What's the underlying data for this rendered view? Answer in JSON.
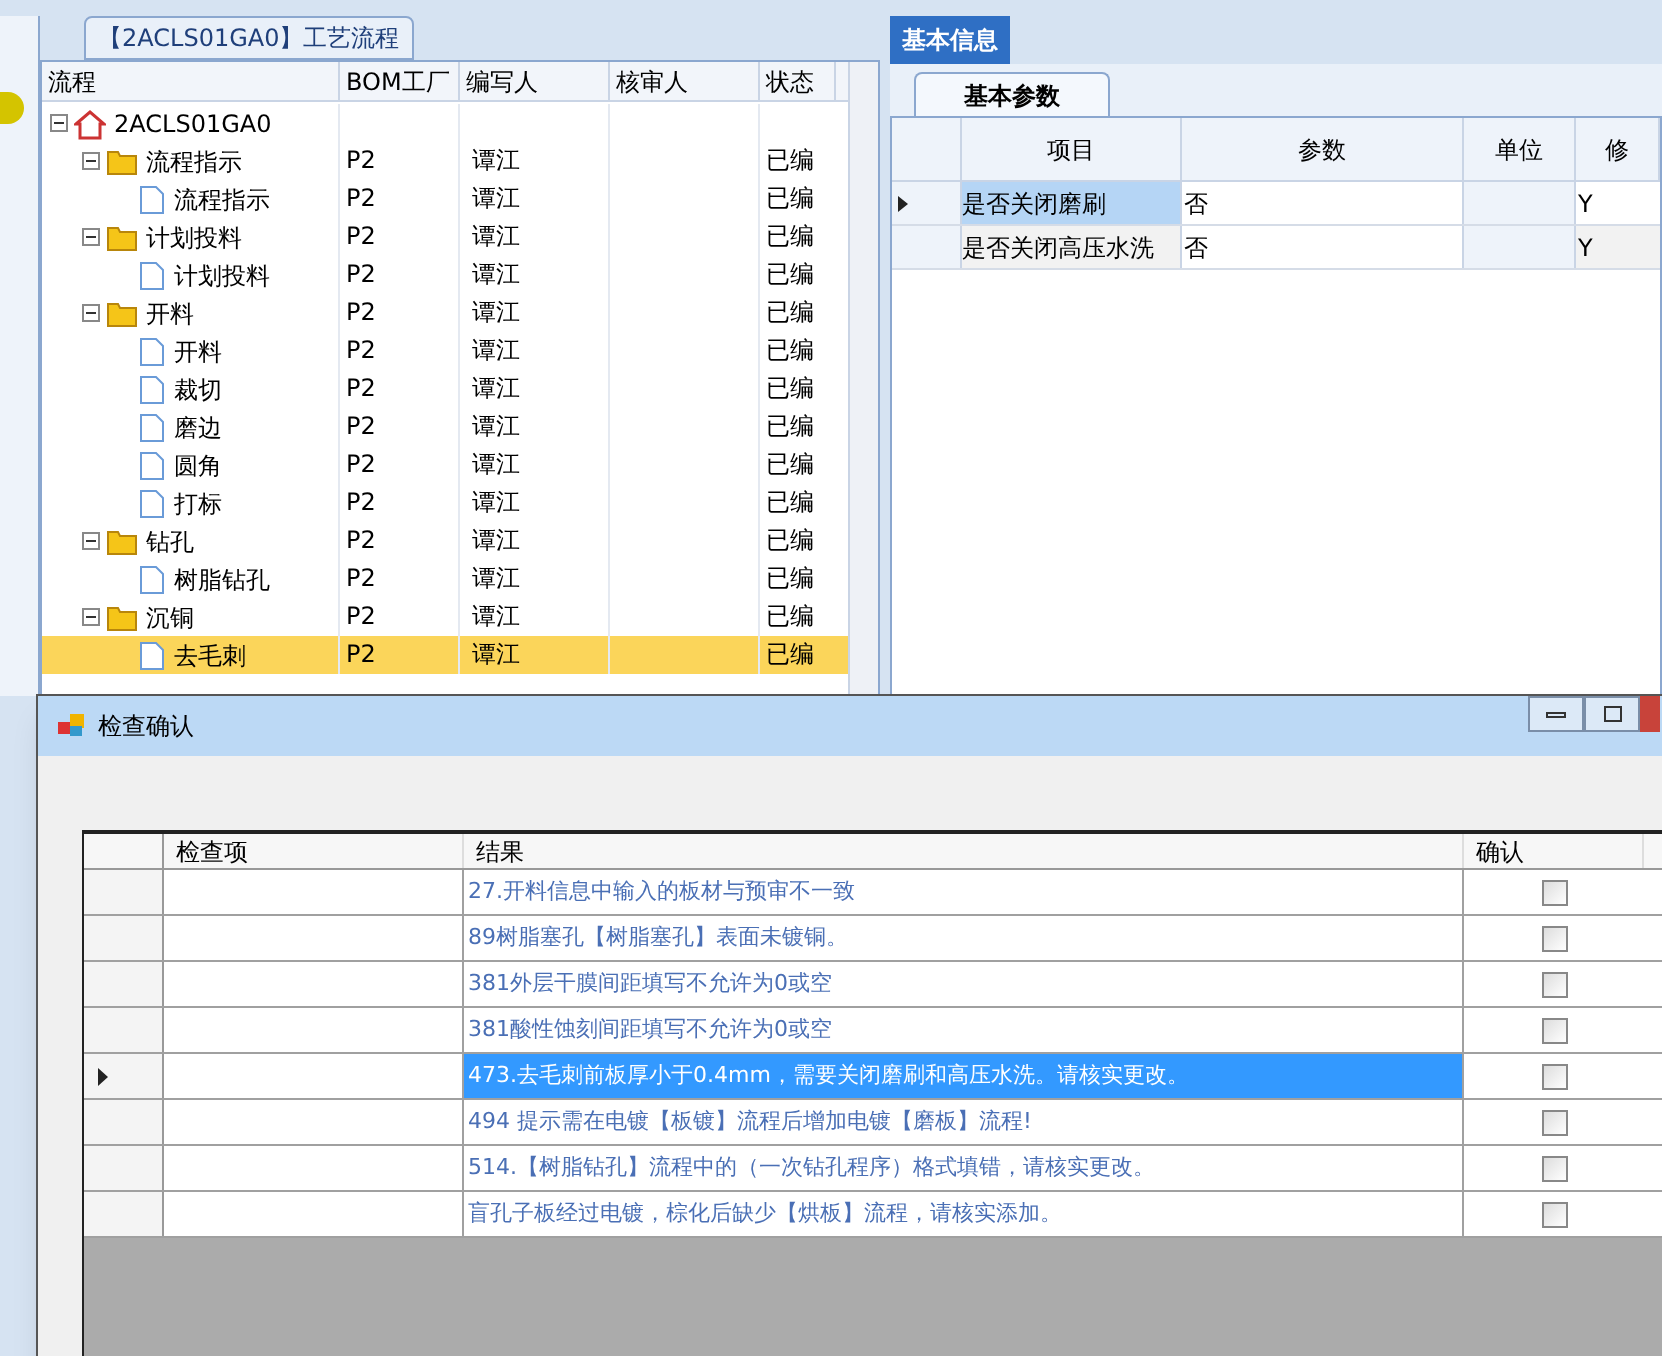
{
  "tree_panel": {
    "tab": "【2ACLS01GA0】工艺流程",
    "columns": [
      "流程",
      "BOM工厂",
      "编写人",
      "核审人",
      "状态"
    ],
    "tree": [
      {
        "kind": "root",
        "label": "2ACLS01GA0",
        "selected": false,
        "expanded": true,
        "children": [
          {
            "kind": "group",
            "label": "流程指示",
            "bom": "P2",
            "writer": "谭江",
            "status": "已编",
            "selected": false,
            "expanded": true,
            "children": [
              {
                "kind": "leaf",
                "label": "流程指示",
                "bom": "P2",
                "writer": "谭江",
                "status": "已编",
                "selected": false
              }
            ]
          },
          {
            "kind": "group",
            "label": "计划投料",
            "bom": "P2",
            "writer": "谭江",
            "status": "已编",
            "selected": false,
            "expanded": true,
            "children": [
              {
                "kind": "leaf",
                "label": "计划投料",
                "bom": "P2",
                "writer": "谭江",
                "status": "已编",
                "selected": false
              }
            ]
          },
          {
            "kind": "group",
            "label": "开料",
            "bom": "P2",
            "writer": "谭江",
            "status": "已编",
            "selected": false,
            "expanded": true,
            "children": [
              {
                "kind": "leaf",
                "label": "开料",
                "bom": "P2",
                "writer": "谭江",
                "status": "已编",
                "selected": false
              },
              {
                "kind": "leaf",
                "label": "裁切",
                "bom": "P2",
                "writer": "谭江",
                "status": "已编",
                "selected": false
              },
              {
                "kind": "leaf",
                "label": "磨边",
                "bom": "P2",
                "writer": "谭江",
                "status": "已编",
                "selected": false
              },
              {
                "kind": "leaf",
                "label": "圆角",
                "bom": "P2",
                "writer": "谭江",
                "status": "已编",
                "selected": false
              },
              {
                "kind": "leaf",
                "label": "打标",
                "bom": "P2",
                "writer": "谭江",
                "status": "已编",
                "selected": false
              }
            ]
          },
          {
            "kind": "group",
            "label": "钻孔",
            "bom": "P2",
            "writer": "谭江",
            "status": "已编",
            "selected": false,
            "expanded": true,
            "children": [
              {
                "kind": "leaf",
                "label": "树脂钻孔",
                "bom": "P2",
                "writer": "谭江",
                "status": "已编",
                "selected": false
              }
            ]
          },
          {
            "kind": "group",
            "label": "沉铜",
            "bom": "P2",
            "writer": "谭江",
            "status": "已编",
            "selected": false,
            "expanded": true,
            "children": [
              {
                "kind": "leaf",
                "label": "去毛刺",
                "bom": "P2",
                "writer": "谭江",
                "status": "已编",
                "selected": true
              }
            ]
          }
        ]
      }
    ]
  },
  "info_panel": {
    "tabs": [
      {
        "label": "基本信息",
        "selected": true
      }
    ],
    "subtabs": [
      {
        "label": "基本参数",
        "selected": true
      }
    ],
    "columns": [
      "项目",
      "参数",
      "单位",
      "修"
    ],
    "rows": [
      {
        "item": "是否关闭磨刷",
        "param": "否",
        "modify": "Y",
        "selected": true
      },
      {
        "item": "是否关闭高压水洗",
        "param": "否",
        "modify": "Y",
        "selected": false
      }
    ]
  },
  "dialog": {
    "title": "检查确认",
    "columns": [
      "检查项",
      "结果",
      "确认"
    ],
    "rows": [
      {
        "result": "27.开料信息中输入的板材与预审不一致",
        "checked": false,
        "selected": false
      },
      {
        "result": "89树脂塞孔【树脂塞孔】表面未镀铜。",
        "checked": false,
        "selected": false
      },
      {
        "result": "381外层干膜间距填写不允许为0或空",
        "checked": false,
        "selected": false
      },
      {
        "result": "381酸性蚀刻间距填写不允许为0或空",
        "checked": false,
        "selected": false
      },
      {
        "result": "473.去毛刺前板厚小于0.4mm，需要关闭磨刷和高压水洗。请核实更改。",
        "checked": false,
        "selected": true
      },
      {
        "result": "494 提示需在电镀【板镀】流程后增加电镀【磨板】流程!",
        "checked": false,
        "selected": false
      },
      {
        "result": "514.【树脂钻孔】流程中的（一次钻孔程序）格式填错，请核实更改。",
        "checked": false,
        "selected": false
      },
      {
        "result": "盲孔子板经过电镀，棕化后缺少【烘板】流程，请核实添加。",
        "checked": false,
        "selected": false
      }
    ]
  }
}
